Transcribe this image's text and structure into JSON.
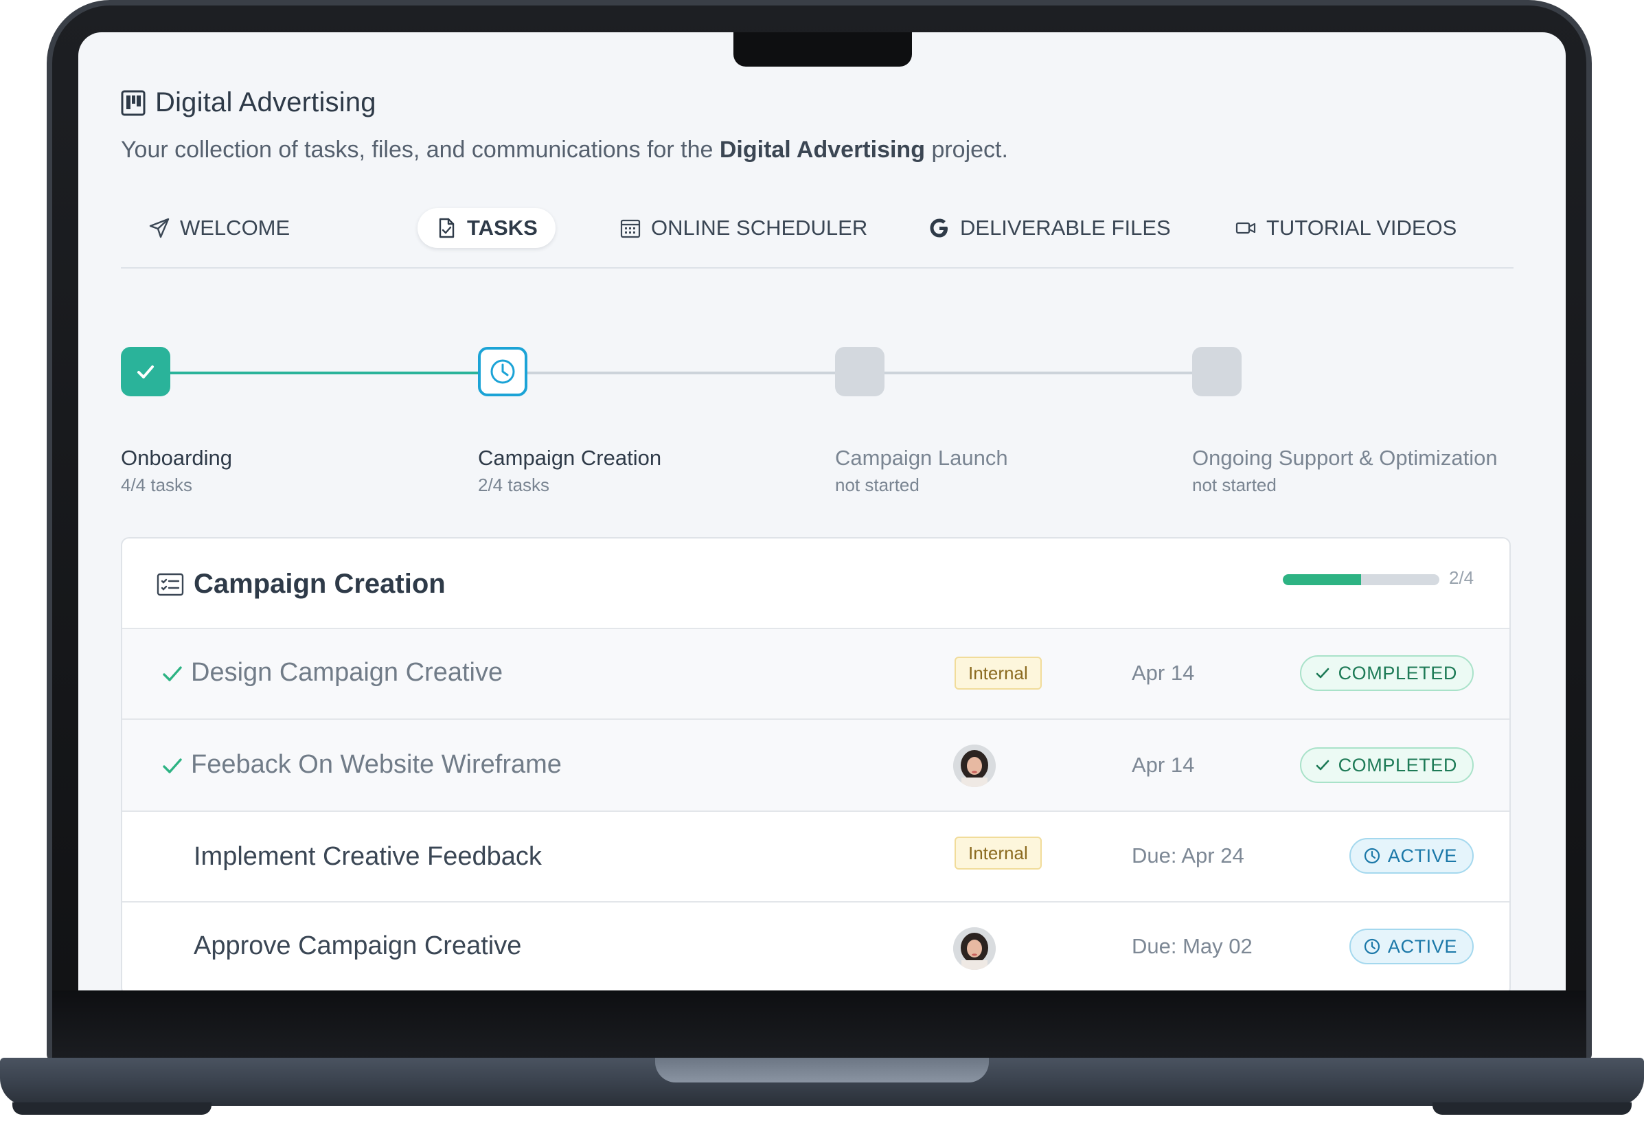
{
  "project": {
    "title": "Digital Advertising",
    "subtitle_prefix": "Your collection of tasks, files, and communications for the",
    "subtitle_bold": "Digital Advertising",
    "subtitle_suffix": "project."
  },
  "tabs": [
    {
      "label": "WELCOME",
      "icon": "send-icon",
      "active": false
    },
    {
      "label": "TASKS",
      "icon": "file-check-icon",
      "active": true
    },
    {
      "label": "ONLINE SCHEDULER",
      "icon": "calendar-icon",
      "active": false
    },
    {
      "label": "DELIVERABLE FILES",
      "icon": "google-g-icon",
      "active": false
    },
    {
      "label": "TUTORIAL VIDEOS",
      "icon": "video-camera-icon",
      "active": false
    }
  ],
  "stages": [
    {
      "label": "Onboarding",
      "sub": "4/4 tasks",
      "state": "completed",
      "icon": "checkmark-icon"
    },
    {
      "label": "Campaign Creation",
      "sub": "2/4 tasks",
      "state": "active",
      "icon": "clock-icon"
    },
    {
      "label": "Campaign Launch",
      "sub": "not started",
      "state": "pending"
    },
    {
      "label": "Ongoing Support & Optimization",
      "sub": "not started",
      "state": "pending"
    }
  ],
  "card": {
    "title": "Campaign Creation",
    "icon": "task-list-icon",
    "progress_text": "2/4",
    "progress_fraction": 0.5
  },
  "tasks": [
    {
      "name": "Design Campaign Creative",
      "done": true,
      "assignee": "tag",
      "tag": "Internal",
      "date": "Apr 14",
      "status": "COMPLETED"
    },
    {
      "name": "Feeback On Website Wireframe",
      "done": true,
      "assignee": "avatar",
      "date": "Apr 14",
      "status": "COMPLETED"
    },
    {
      "name": "Implement Creative Feedback",
      "done": false,
      "assignee": "tag",
      "tag": "Internal",
      "date": "Due: Apr 24",
      "status": "ACTIVE"
    },
    {
      "name": "Approve Campaign Creative",
      "done": false,
      "assignee": "avatar",
      "date": "Due: May 02",
      "status": "ACTIVE"
    }
  ],
  "colors": {
    "accent_teal": "#2ab39a",
    "active_blue": "#1ba3d6",
    "pending_gray": "#d3d8de",
    "completed_green": "#1d7a56",
    "internal_tag": "#fdf6dc"
  }
}
